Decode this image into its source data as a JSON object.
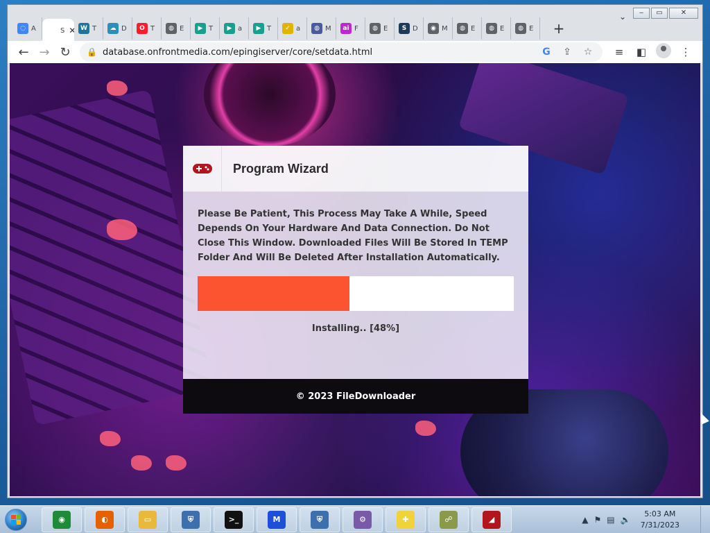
{
  "browser": {
    "tabs": [
      {
        "label": "A",
        "icon": "loading-icon",
        "color": "#4285f4"
      },
      {
        "label": "S",
        "icon": "page-icon",
        "color": "#ffffff",
        "active": true
      },
      {
        "label": "T",
        "icon": "wordpress-icon",
        "color": "#21759b"
      },
      {
        "label": "D",
        "icon": "cloud-icon",
        "color": "#2a8fbd"
      },
      {
        "label": "T",
        "icon": "opera-icon",
        "color": "#ff1b2d"
      },
      {
        "label": "E",
        "icon": "globe-icon",
        "color": "#5f6368"
      },
      {
        "label": "T",
        "icon": "play-icon",
        "color": "#1a9e8f"
      },
      {
        "label": "a",
        "icon": "play-icon",
        "color": "#1a9e8f"
      },
      {
        "label": "T",
        "icon": "play-icon",
        "color": "#1a9e8f"
      },
      {
        "label": "a",
        "icon": "check-icon",
        "color": "#e0b400"
      },
      {
        "label": "M",
        "icon": "globe-icon",
        "color": "#4a5a9a"
      },
      {
        "label": "F",
        "icon": "ai-icon",
        "color": "#c026d3"
      },
      {
        "label": "E",
        "icon": "globe-icon",
        "color": "#5f6368"
      },
      {
        "label": "D",
        "icon": "s-icon",
        "color": "#1c3b5a"
      },
      {
        "label": "M",
        "icon": "chrome-icon",
        "color": "#5f6368"
      },
      {
        "label": "E",
        "icon": "globe-icon",
        "color": "#5f6368"
      },
      {
        "label": "E",
        "icon": "globe-icon",
        "color": "#5f6368"
      },
      {
        "label": "E",
        "icon": "globe-icon",
        "color": "#5f6368"
      }
    ],
    "active_tab_close": "✕",
    "new_tab": "+",
    "url": "database.onfrontmedia.com/epingiserver/core/setdata.html"
  },
  "wizard": {
    "title": "Program Wizard",
    "message": "Please Be Patient, This Process May Take A While, Speed Depends On Your Hardware And Data Connection. Do Not Close This Window. Downloaded Files Will Be Stored In TEMP Folder And Will Be Deleted After Installation Automatically.",
    "progress_fraction": 0.48,
    "status": "Installing.. [48%]",
    "footer": "© 2023 FileDownloader",
    "accent_color": "#fc5430"
  },
  "taskbar": {
    "apps": [
      {
        "name": "chrome",
        "icon": "chrome-icon"
      },
      {
        "name": "firefox",
        "icon": "firefox-icon"
      },
      {
        "name": "explorer",
        "icon": "folder-icon"
      },
      {
        "name": "security",
        "icon": "shield-icon"
      },
      {
        "name": "terminal",
        "icon": "terminal-icon"
      },
      {
        "name": "malwarebytes",
        "icon": "malwarebytes-icon"
      },
      {
        "name": "defender",
        "icon": "shield-icon"
      },
      {
        "name": "installer",
        "icon": "setup-icon"
      },
      {
        "name": "puzzle",
        "icon": "puzzle-icon"
      },
      {
        "name": "network",
        "icon": "network-icon"
      },
      {
        "name": "recorder",
        "icon": "recorder-icon"
      }
    ],
    "clock_time": "5:03 AM",
    "clock_date": "7/31/2023"
  }
}
